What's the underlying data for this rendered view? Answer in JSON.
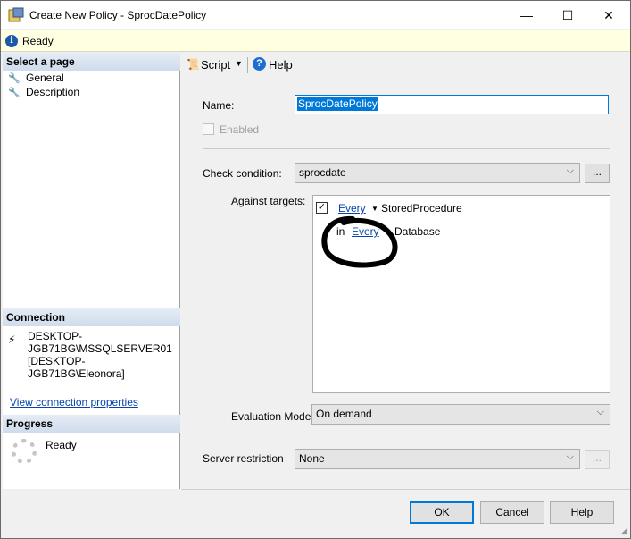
{
  "window": {
    "title": "Create New Policy - SprocDatePolicy",
    "controls": {
      "minimize": "—",
      "maximize": "☐",
      "close": "✕"
    }
  },
  "status": {
    "text": "Ready",
    "icon": "info-icon"
  },
  "left": {
    "select_page_header": "Select a page",
    "pages": [
      {
        "label": "General",
        "icon": "wrench-icon"
      },
      {
        "label": "Description",
        "icon": "wrench-icon"
      }
    ],
    "connection_header": "Connection",
    "connection_text": "DESKTOP-JGB71BG\\MSSQLSERVER01 [DESKTOP-JGB71BG\\Eleonora]",
    "connection_link": "View connection properties",
    "progress_header": "Progress",
    "progress_status": "Ready"
  },
  "toolbar": {
    "script_label": "Script",
    "help_label": "Help"
  },
  "form": {
    "name_label": "Name:",
    "name_value": "SprocDatePolicy",
    "enabled_label": "Enabled",
    "check_condition_label": "Check condition:",
    "check_condition_value": "sprocdate",
    "against_targets_label": "Against targets:",
    "targets": {
      "row1_link": "Every",
      "row1_text": "StoredProcedure",
      "row2_prefix": "in",
      "row2_link": "Every",
      "row2_text": "Database"
    },
    "evaluation_mode_label": "Evaluation Mode:",
    "evaluation_mode_value": "On demand",
    "server_restriction_label": "Server restriction",
    "server_restriction_value": "None",
    "ellipsis": "..."
  },
  "buttons": {
    "ok": "OK",
    "cancel": "Cancel",
    "help": "Help"
  }
}
